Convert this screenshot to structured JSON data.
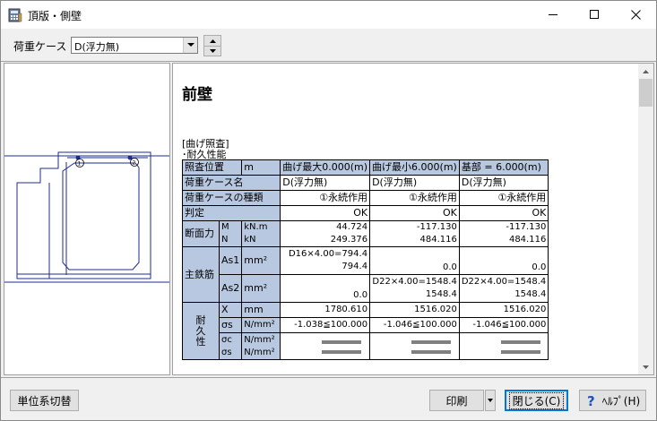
{
  "window": {
    "title": "頂版・側壁",
    "icon": "calculator-app-icon"
  },
  "toolbar": {
    "case_label": "荷重ケース",
    "case_value": "D(浮力無)"
  },
  "document": {
    "heading": "前壁",
    "section1": "[曲げ照査]",
    "section2": "･耐久性能",
    "table": {
      "hdr_position": "照査位置",
      "hdr_unit": "m",
      "col1_header": "曲げ最大0.000(m)",
      "col2_header": "曲げ最小6.000(m)",
      "col3_header": "基部 = 6.000(m)",
      "case_name_label": "荷重ケース名",
      "case_name_1": "D(浮力無)",
      "case_name_2": "D(浮力無)",
      "case_name_3": "D(浮力無)",
      "case_type_label": "荷重ケースの種類",
      "case_type_1": "①永続作用",
      "case_type_2": "①永続作用",
      "case_type_3": "①永続作用",
      "judge_label": "判定",
      "judge_1": "OK",
      "judge_2": "OK",
      "judge_3": "OK",
      "section_force_label": "断面力",
      "sym_m": "M",
      "sym_n": "N",
      "unit_knm": "kN.m",
      "unit_kn": "kN",
      "m_1": "44.724",
      "n_1": "249.376",
      "m_2": "-117.130",
      "n_2": "484.116",
      "m_3": "-117.130",
      "n_3": "484.116",
      "main_rebar_label": "主鉄筋",
      "as1_label": "As1",
      "as2_label": "As2",
      "unit_mm2": "mm²",
      "as1_1a": "D16×4.00=794.4",
      "as1_1b": "794.4",
      "as1_2": "0.0",
      "as1_3": "0.0",
      "as2_1": "0.0",
      "as2_2a": "D22×4.00=1548.4",
      "as2_2b": "1548.4",
      "as2_3a": "D22×4.00=1548.4",
      "as2_3b": "1548.4",
      "durability_label_1": "耐",
      "durability_label_2": "久",
      "durability_label_3": "性",
      "x_label": "X",
      "unit_mm": "mm",
      "x_1": "1780.610",
      "x_2": "1516.020",
      "x_3": "1516.020",
      "sigma_s_label": "σs",
      "sigma_c_label": "σc",
      "unit_nmm2": "N/mm²",
      "sigma_s_1": "-1.038≦100.000",
      "sigma_s_2": "-1.046≦100.000",
      "sigma_s_3": "-1.046≦100.000"
    }
  },
  "buttons": {
    "unit_switch": "単位系切替",
    "print": "印刷",
    "close": "閉じる(C)",
    "help": "ﾍﾙﾌﾟ(H)"
  }
}
